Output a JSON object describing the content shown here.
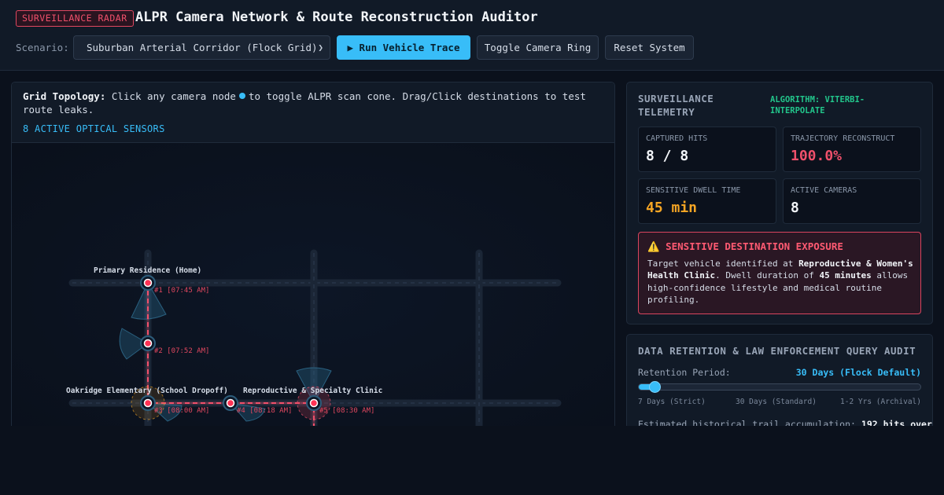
{
  "header": {
    "badge": "SURVEILLANCE RADAR",
    "title": "ALPR Camera Network & Route Reconstruction Auditor",
    "scenario_label": "Scenario:",
    "scenario_value": "Suburban Arterial Corridor (Flock Grid)",
    "run_button": "▶ Run Vehicle Trace",
    "toggle_button": "Toggle Camera Ring",
    "reset_button": "Reset System"
  },
  "map": {
    "topology_label": "Grid Topology:",
    "topology_text_1": "Click any camera node",
    "topology_text_2": "to toggle ALPR scan cone. Drag/Click destinations to test route leaks.",
    "sensor_count": "8 ACTIVE OPTICAL SENSORS",
    "destinations": [
      {
        "label": "Primary Residence (Home)"
      },
      {
        "label": "Oakridge Elementary (School Dropoff)"
      },
      {
        "label": "Reproductive & Specialty Clinic"
      }
    ],
    "cameras": [
      {
        "label": "#1 [07:45 AM]"
      },
      {
        "label": "#2 [07:52 AM]"
      },
      {
        "label": "#3 [08:00 AM]"
      },
      {
        "label": "#4 [08:18 AM]"
      },
      {
        "label": "#5 [08:30 AM]"
      }
    ]
  },
  "telemetry": {
    "title": "SURVEILLANCE TELEMETRY",
    "algorithm": "ALGORITHM: VITERBI-INTERPOLATE",
    "stats": [
      {
        "label": "CAPTURED HITS",
        "value": "8 / 8",
        "color": "#f2f5f9"
      },
      {
        "label": "TRAJECTORY RECONSTRUCT",
        "value": "100.0%",
        "color": "#f0506b"
      },
      {
        "label": "SENSITIVE DWELL TIME",
        "value": "45 min",
        "color": "#f5a524"
      },
      {
        "label": "ACTIVE CAMERAS",
        "value": "8",
        "color": "#f2f5f9"
      }
    ],
    "alert": {
      "title": "SENSITIVE DESTINATION EXPOSURE",
      "body_1": "Target vehicle identified at ",
      "body_place": "Reproductive & Women's Health Clinic",
      "body_2": ". Dwell duration of ",
      "body_duration": "45 minutes",
      "body_3": " allows high-confidence lifestyle and medical routine profiling."
    }
  },
  "retention": {
    "title": "DATA RETENTION & LAW ENFORCEMENT QUERY AUDIT",
    "label": "Retention Period:",
    "value": "30 Days (Flock Default)",
    "slider_fraction": 0.04,
    "ticks": [
      "7 Days (Strict)",
      "30 Days (Standard)",
      "1-2 Yrs (Archival)"
    ],
    "estimate_label": "Estimated historical trail accumulation:",
    "estimate_value": "192 hits over"
  }
}
